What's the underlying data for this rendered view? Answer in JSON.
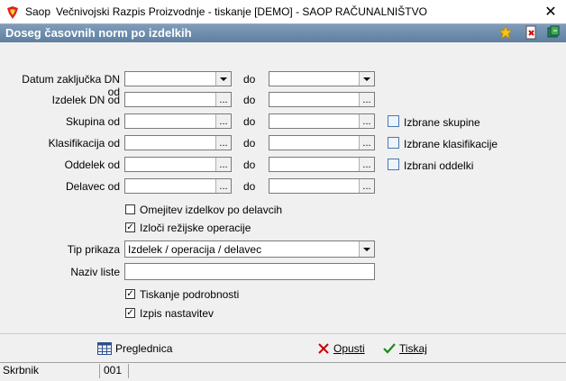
{
  "window": {
    "app_name": "Saop",
    "title": "Večnivojski Razpis Proizvodnje - tiskanje [DEMO] - SAOP RAČUNALNIŠTVO",
    "close_glyph": "✕"
  },
  "form": {
    "title": "Doseg časovnih norm po izdelkih"
  },
  "labels": {
    "datum": "Datum zaključka DN od",
    "izdelek": "Izdelek DN od",
    "skupina": "Skupina od",
    "klasifikacija": "Klasifikacija od",
    "oddelek": "Oddelek od",
    "delavec": "Delavec od",
    "do": "do",
    "tip_prikaza": "Tip prikaza",
    "naziv_liste": "Naziv liste"
  },
  "ellipsis": "...",
  "links": {
    "skupine": "Izbrane skupine",
    "klasifikacije": "Izbrane klasifikacije",
    "oddelki": "Izbrani oddelki"
  },
  "checkboxes": {
    "omejitev": {
      "label": "Omejitev izdelkov po delavcih",
      "mark": ""
    },
    "izloci": {
      "label": "Izloči režijske operacije",
      "mark": "✓"
    },
    "tiskanje": {
      "label": "Tiskanje podrobnosti",
      "mark": "✓"
    },
    "izpis": {
      "label": "Izpis nastavitev",
      "mark": "✓"
    }
  },
  "tip_prikaza_value": "Izdelek / operacija / delavec",
  "naziv_liste_value": "",
  "buttons": {
    "preglednica": "Preglednica",
    "opusti": "Opusti",
    "tiskaj": "Tiskaj"
  },
  "status": {
    "user": "Skrbnik",
    "code": "001"
  }
}
